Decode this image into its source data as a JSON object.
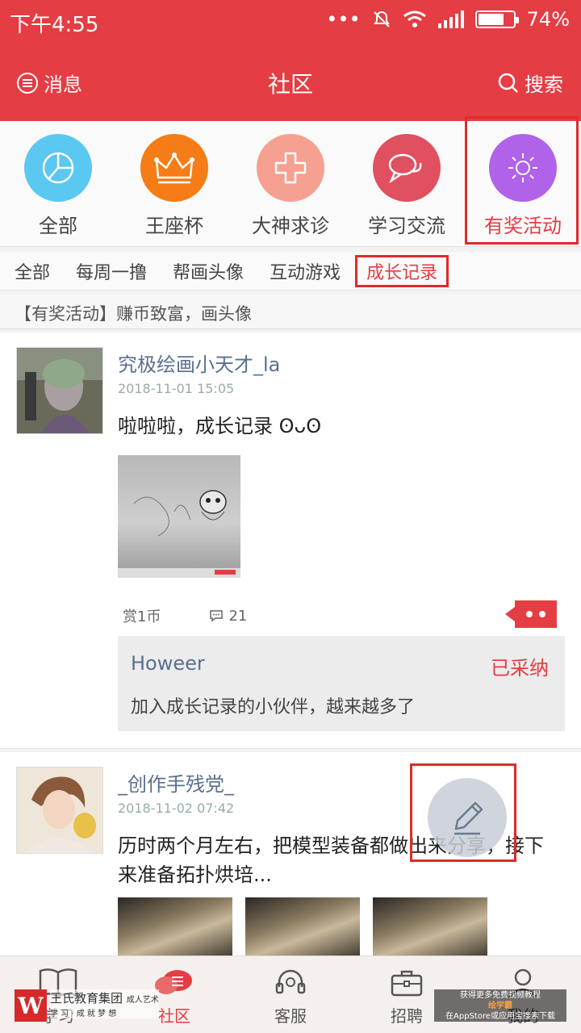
{
  "status_bar": {
    "time": "下午4:55",
    "dots": "•••",
    "battery": "74%",
    "battery_level": 0.74
  },
  "header": {
    "messages_label": "消息",
    "title": "社区",
    "search_label": "搜索"
  },
  "categories": [
    {
      "label": "全部",
      "color": "#5ac8f0",
      "icon": "pie-chart-icon"
    },
    {
      "label": "王座杯",
      "color": "#f57c16",
      "icon": "crown-icon"
    },
    {
      "label": "大神求诊",
      "color": "#f5a090",
      "icon": "medical-cross-icon"
    },
    {
      "label": "学习交流",
      "color": "#e05060",
      "icon": "chat-bubbles-icon"
    },
    {
      "label": "有奖活动",
      "color": "#b062e8",
      "icon": "sun-icon"
    }
  ],
  "subtabs": [
    "全部",
    "每周一撸",
    "帮画头像",
    "互动游戏",
    "成长记录"
  ],
  "notice": "【有奖活动】赚币致富，画头像",
  "posts": [
    {
      "user": "究极绘画小天才_la",
      "date": "2018-11-01 15:05",
      "text": "啦啦啦，成长记录 ʘᴗʘ",
      "reward": "赏1币",
      "comments": "21",
      "reply": {
        "name": "Howeer",
        "status": "已采纳",
        "text": "加入成长记录的小伙伴，越来越多了"
      }
    },
    {
      "user": "_创作手残党_",
      "date": "2018-11-02 07:42",
      "text": "历时两个月左右，把模型装备都做出来分享，接下来准备拓扑烘培..."
    }
  ],
  "bottom_nav": [
    {
      "label": "学习",
      "icon": "book-icon"
    },
    {
      "label": "社区",
      "icon": "chat-icon"
    },
    {
      "label": "客服",
      "icon": "headset-icon"
    },
    {
      "label": "招聘",
      "icon": "briefcase-icon"
    },
    {
      "label": "我的",
      "icon": "person-icon"
    }
  ],
  "watermark": {
    "logo": "W",
    "left_line1": "王氏教育集团",
    "left_line2": "学 习 · 成 就 梦 想",
    "left_badge": "成人艺术",
    "right_line1": "获得更多免费视频教程",
    "right_line2": "绘学霸",
    "right_line3": "在AppStore或应用宝搜索下载"
  },
  "colors": {
    "brand_red": "#e43d43",
    "link_blue": "#5a6f90"
  }
}
